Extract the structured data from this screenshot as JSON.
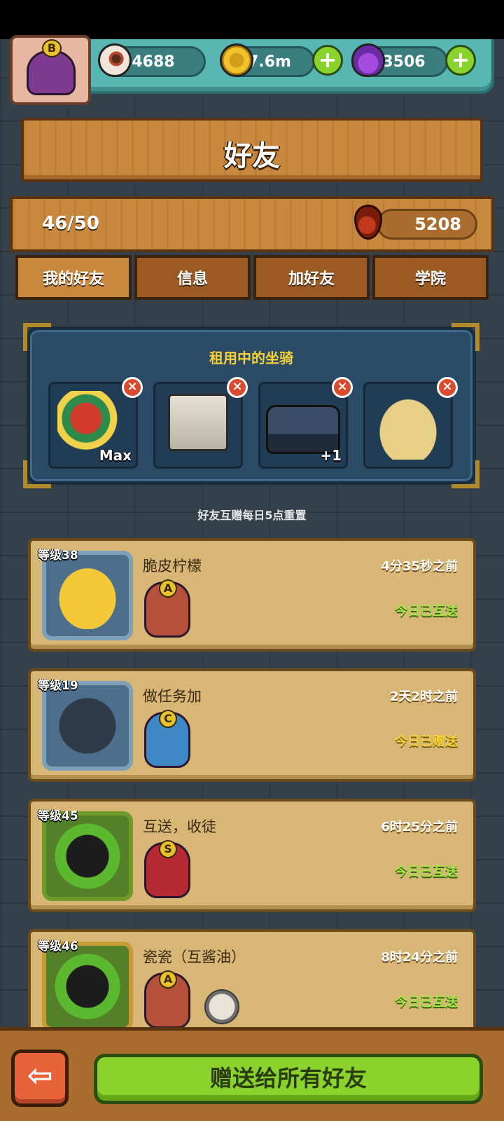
{
  "resources": {
    "eyes": "4688",
    "coins": "7.6m",
    "potions": "3506",
    "plus": "+"
  },
  "rank_badge": "B",
  "title": "好友",
  "friend_count": "46/50",
  "blood": "5208",
  "tabs": [
    "我的好友",
    "信息",
    "加好友",
    "学院"
  ],
  "mounts": {
    "title": "租用中的坐骑",
    "close": "×",
    "items": [
      {
        "tag": "Max",
        "icon": "lion-dance-mount"
      },
      {
        "tag": "",
        "icon": "machine-mount"
      },
      {
        "tag": "+1",
        "icon": "tank-mount"
      },
      {
        "tag": "",
        "icon": "cloud-mount"
      }
    ]
  },
  "reset_note": "好友互赠每日5点重置",
  "friends": [
    {
      "level": "等级38",
      "name": "脆皮柠檬",
      "time": "4分35秒之前",
      "rank": "A",
      "status": "今日已互送"
    },
    {
      "level": "等级19",
      "name": "做任务加",
      "time": "2天2时之前",
      "rank": "C",
      "status": "今日已赠送"
    },
    {
      "level": "等级45",
      "name": "互送，收徒",
      "time": "6时25分之前",
      "rank": "S",
      "status": "今日已互送"
    },
    {
      "level": "等级46",
      "name": "瓷瓷（互酱油）",
      "time": "8时24分之前",
      "rank": "A",
      "status": "今日已互送"
    }
  ],
  "bottom": {
    "back": "⇦",
    "gift_all": "赠送给所有好友"
  },
  "colors": {
    "accent_green": "#8ad32c",
    "status_green": "#a6e24a",
    "status_yellow": "#f5d23a"
  }
}
